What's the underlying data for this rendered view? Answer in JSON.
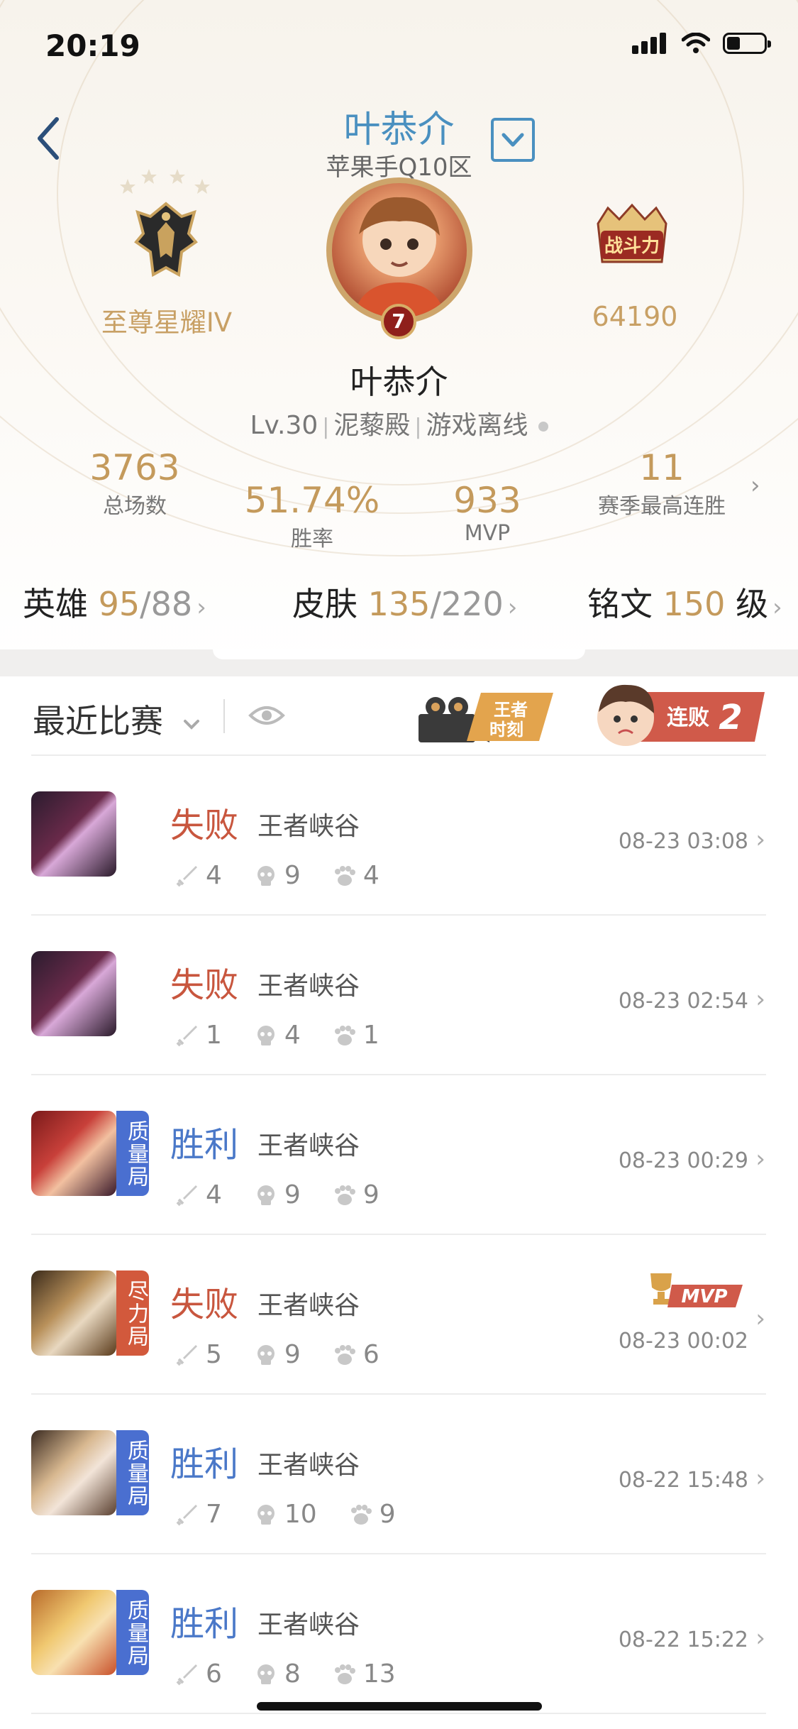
{
  "status_bar": {
    "time": "20:19"
  },
  "profile": {
    "name": "叶恭介",
    "server": "苹果手Q10区",
    "nickname": "叶恭介",
    "vip_level": "7",
    "level": "Lv.30",
    "guild": "泥藜殿",
    "status": "游戏离线",
    "rank": "至尊星耀IV",
    "power_badge": "战斗力",
    "power": "64190"
  },
  "stats": {
    "total_games": "3763",
    "total_games_label": "总场数",
    "win_rate": "51.74%",
    "win_rate_label": "胜率",
    "mvp": "933",
    "mvp_label": "MVP",
    "best_streak": "11",
    "best_streak_label": "赛季最高连胜"
  },
  "collections": {
    "heroes_label": "英雄",
    "heroes_owned": "95",
    "heroes_total": "/88",
    "skins_label": "皮肤",
    "skins_owned": "135",
    "skins_total": "/220",
    "runes_label": "铭文",
    "runes_level": "150",
    "runes_unit": "级"
  },
  "recent": {
    "title": "最近比赛",
    "moment_badge_l1": "王者",
    "moment_badge_l2": "时刻",
    "streak_badge": "连败",
    "streak_count": "2"
  },
  "matches": [
    {
      "result": "失败",
      "mode": "王者峡谷",
      "kills": "4",
      "deaths": "9",
      "assists": "4",
      "time": "08-23 03:08",
      "tag": "",
      "mvp": ""
    },
    {
      "result": "失败",
      "mode": "王者峡谷",
      "kills": "1",
      "deaths": "4",
      "assists": "1",
      "time": "08-23 02:54",
      "tag": "",
      "mvp": ""
    },
    {
      "result": "胜利",
      "mode": "王者峡谷",
      "kills": "4",
      "deaths": "9",
      "assists": "9",
      "time": "08-23 00:29",
      "tag": "质量局",
      "mvp": ""
    },
    {
      "result": "失败",
      "mode": "王者峡谷",
      "kills": "5",
      "deaths": "9",
      "assists": "6",
      "time": "08-23 00:02",
      "tag": "尽力局",
      "mvp": "MVP"
    },
    {
      "result": "胜利",
      "mode": "王者峡谷",
      "kills": "7",
      "deaths": "10",
      "assists": "9",
      "time": "08-22 15:48",
      "tag": "质量局",
      "mvp": ""
    },
    {
      "result": "胜利",
      "mode": "王者峡谷",
      "kills": "6",
      "deaths": "8",
      "assists": "13",
      "time": "08-22 15:22",
      "tag": "质量局",
      "mvp": ""
    }
  ],
  "colors": {
    "win": "#4a78c8",
    "lose": "#c8563e",
    "gold": "#c49a5c",
    "quality_tag": "#4a6fd0",
    "effort_tag": "#d2593c"
  }
}
